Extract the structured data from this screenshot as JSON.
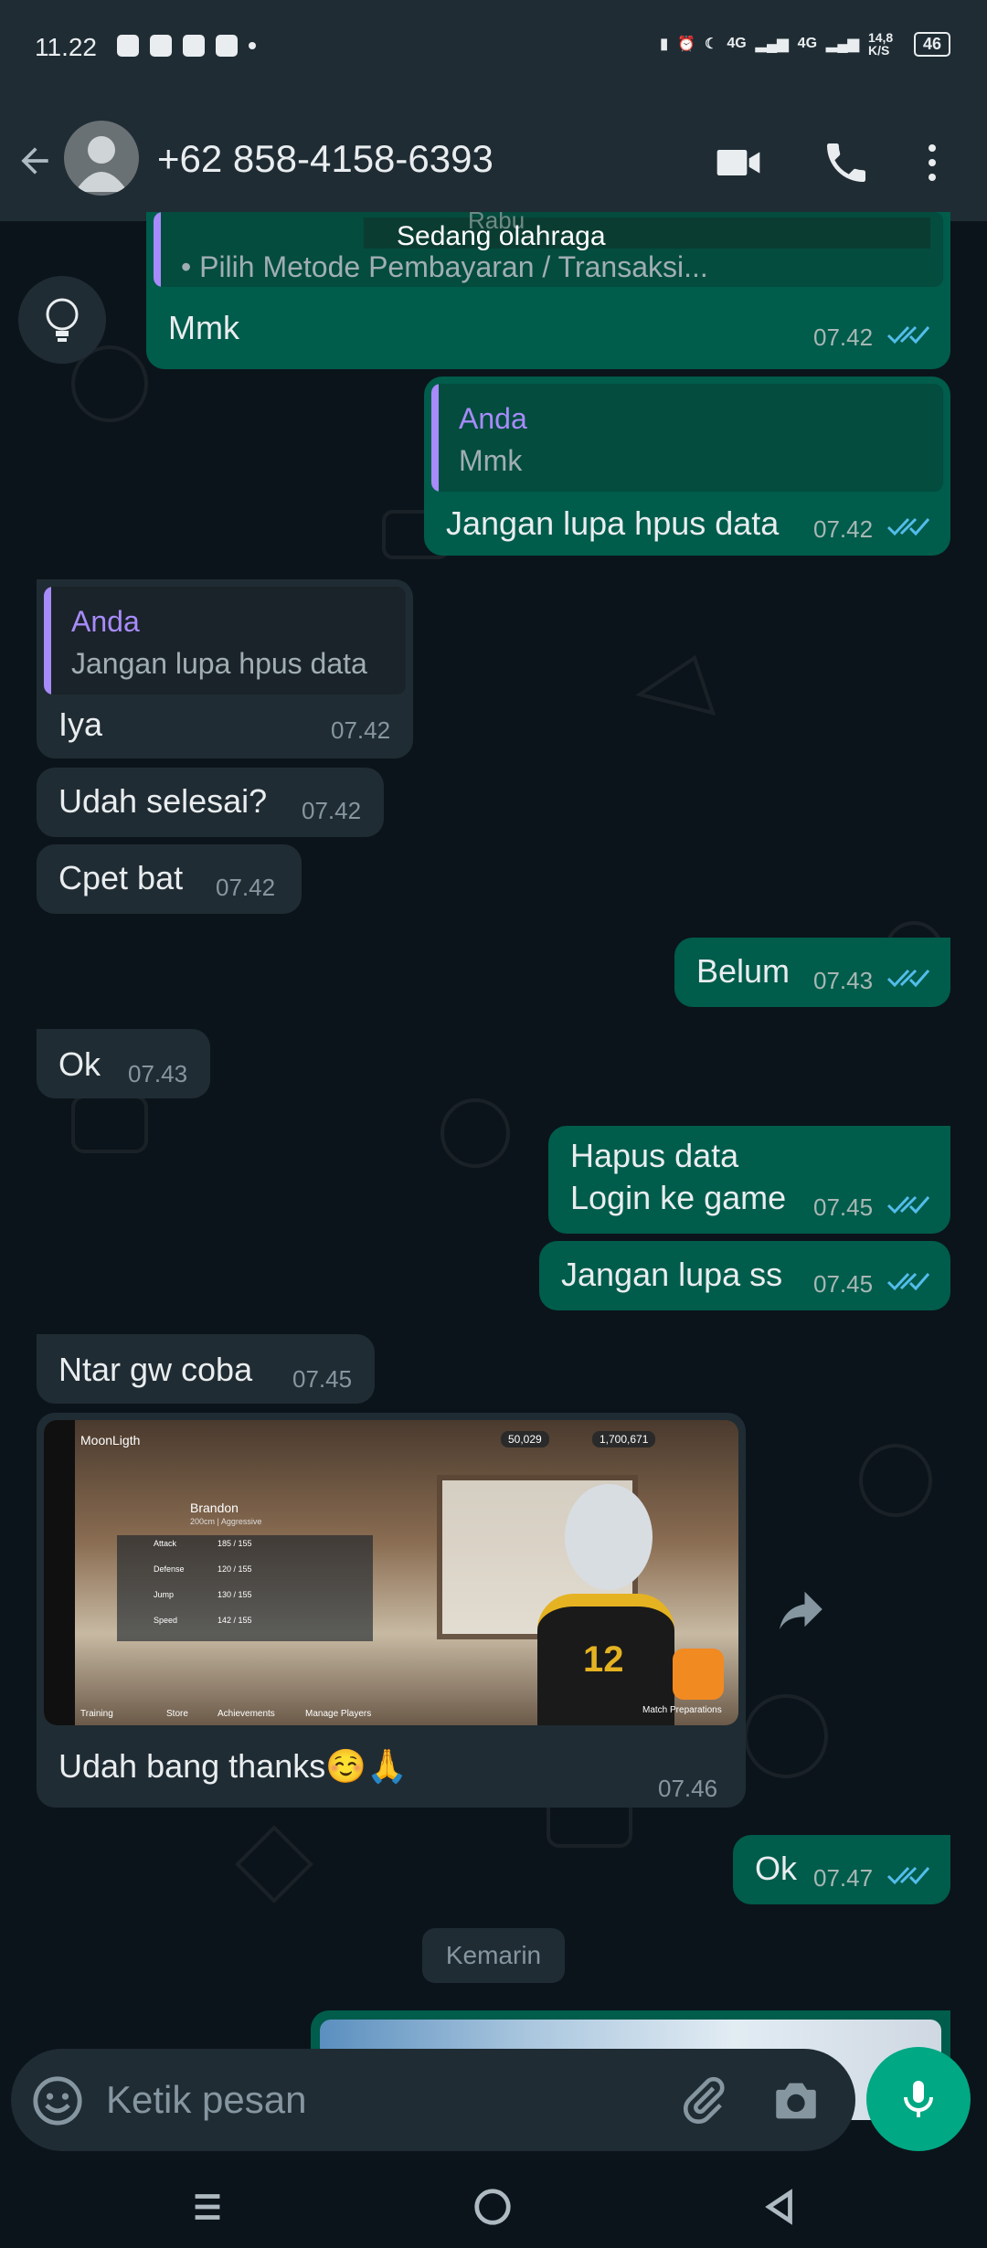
{
  "status_bar": {
    "time": "11.22",
    "signal_1": "4G",
    "signal_2": "4G",
    "net_speed": "14,8 K/S",
    "battery": "46"
  },
  "header": {
    "title": "+62 858-4158-6393"
  },
  "banner": {
    "text": "Sedang olahraga",
    "day": "Rabu"
  },
  "messages": [
    {
      "id": "m1",
      "dir": "out",
      "quote_text": "• Pilih Metode Pembayaran / Transaksi...",
      "text": "Mmk",
      "time": "07.42"
    },
    {
      "id": "m2",
      "dir": "out",
      "quote_name": "Anda",
      "quote_text": "Mmk",
      "text": "Jangan lupa hpus data",
      "time": "07.42"
    },
    {
      "id": "m3",
      "dir": "in",
      "quote_name": "Anda",
      "quote_text": "Jangan lupa hpus data",
      "text": "Iya",
      "time": "07.42"
    },
    {
      "id": "m4",
      "dir": "in",
      "text": "Udah selesai?",
      "time": "07.42"
    },
    {
      "id": "m5",
      "dir": "in",
      "text": "Cpet bat",
      "time": "07.42"
    },
    {
      "id": "m6",
      "dir": "out",
      "text": "Belum",
      "time": "07.43"
    },
    {
      "id": "m7",
      "dir": "in",
      "text": "Ok",
      "time": "07.43"
    },
    {
      "id": "m8",
      "dir": "out",
      "line1": "Hapus data",
      "line2": "Login ke game",
      "time": "07.45"
    },
    {
      "id": "m9",
      "dir": "out",
      "text": "Jangan lupa ss",
      "time": "07.45"
    },
    {
      "id": "m10",
      "dir": "in",
      "text": "Ntar gw coba",
      "time": "07.45"
    },
    {
      "id": "m11",
      "dir": "in",
      "text": "Udah bang thanks☺️🙏",
      "time": "07.46"
    },
    {
      "id": "m12",
      "dir": "out",
      "text": "Ok",
      "time": "07.47"
    }
  ],
  "game_screenshot": {
    "player": "MoonLigth",
    "coins": "50,029",
    "gold": "1,700,671",
    "character": "Brandon",
    "character_sub": "200cm | Aggressive",
    "jersey_number": "12",
    "stats": [
      {
        "label": "Attack",
        "value": "185 / 155"
      },
      {
        "label": "Defense",
        "value": "120 / 155"
      },
      {
        "label": "Jump",
        "value": "130 / 155"
      },
      {
        "label": "Speed",
        "value": "142 / 155"
      }
    ],
    "menu": [
      "Training",
      "Store",
      "Achievements",
      "Manage Players"
    ],
    "match": "Match Preparations"
  },
  "date_chip": "Kemarin",
  "input": {
    "placeholder": "Ketik pesan"
  },
  "colors": {
    "outgoing": "#005c4b",
    "incoming": "#202c33",
    "accent": "#00a884",
    "quote_name": "#a78bfa",
    "read_tick": "#53bdeb"
  }
}
